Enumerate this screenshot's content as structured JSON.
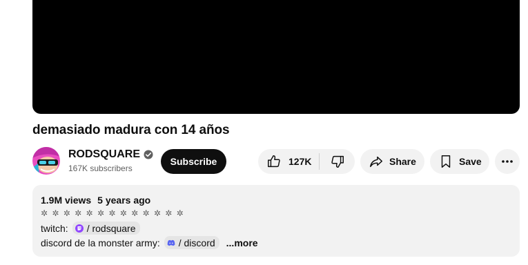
{
  "video": {
    "title": "demasiado madura con 14 años"
  },
  "channel": {
    "name": "RODSQUARE",
    "subscribers": "167K subscribers",
    "avatar_icon": "channel-avatar-icon"
  },
  "actions": {
    "subscribe_label": "Subscribe",
    "like_count": "127K",
    "share_label": "Share",
    "save_label": "Save"
  },
  "description": {
    "views": "1.9M views",
    "age": "5 years ago",
    "stars": "✲ ✲ ✲ ✲ ✲ ✲ ✲ ✲ ✲ ✲ ✲ ✲ ✲",
    "twitch_prefix": "twitch:",
    "twitch_link": "/ rodsquare",
    "discord_prefix": "discord de la monster army:",
    "discord_link": "/ discord",
    "more_label": "...more"
  },
  "colors": {
    "twitch": "#9146ff",
    "discord": "#5865f2",
    "subscribe_bg": "#0f0f0f",
    "pill_bg": "#f2f2f2"
  }
}
